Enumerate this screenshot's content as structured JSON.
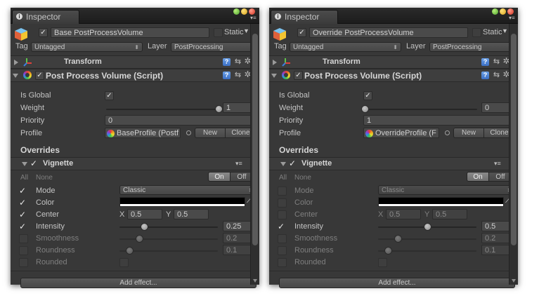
{
  "panels": [
    {
      "tab_title": "Inspector",
      "gameobject": {
        "name": "Base PostProcessVolume",
        "active": true,
        "static_label": "Static",
        "static_checked": false
      },
      "tag_label": "Tag",
      "tag_value": "Untagged",
      "layer_label": "Layer",
      "layer_value": "PostProcessing",
      "transform_title": "Transform",
      "script_title": "Post Process Volume (Script)",
      "is_global_label": "Is Global",
      "is_global": true,
      "weight_label": "Weight",
      "weight_value": "1",
      "weight_fraction": 1.0,
      "priority_label": "Priority",
      "priority_value": "0",
      "profile_label": "Profile",
      "profile_value": "BaseProfile (Postf",
      "new_label": "New",
      "clone_label": "Clone",
      "overrides_label": "Overrides",
      "effect_title": "Vignette",
      "all_label": "All",
      "none_label": "None",
      "on_label": "On",
      "off_label": "Off",
      "mode_label": "Mode",
      "mode_value": "Classic",
      "mode_enabled": true,
      "color_label": "Color",
      "color_enabled": true,
      "center_label": "Center",
      "center_x_label": "X",
      "center_x": "0.5",
      "center_y_label": "Y",
      "center_y": "0.5",
      "center_enabled": true,
      "intensity_label": "Intensity",
      "intensity_value": "0.25",
      "intensity_fraction": 0.25,
      "intensity_enabled": true,
      "smoothness_label": "Smoothness",
      "smoothness_value": "0.2",
      "smoothness_fraction": 0.2,
      "roundness_label": "Roundness",
      "roundness_value": "0.1",
      "roundness_fraction": 0.1,
      "rounded_label": "Rounded",
      "add_effect_label": "Add effect..."
    },
    {
      "tab_title": "Inspector",
      "gameobject": {
        "name": "Override PostProcessVolume",
        "active": true,
        "static_label": "Static",
        "static_checked": false
      },
      "tag_label": "Tag",
      "tag_value": "Untagged",
      "layer_label": "Layer",
      "layer_value": "PostProcessing",
      "transform_title": "Transform",
      "script_title": "Post Process Volume (Script)",
      "is_global_label": "Is Global",
      "is_global": true,
      "weight_label": "Weight",
      "weight_value": "0",
      "weight_fraction": 0.0,
      "priority_label": "Priority",
      "priority_value": "1",
      "profile_label": "Profile",
      "profile_value": "OverrideProfile (F",
      "new_label": "New",
      "clone_label": "Clone",
      "overrides_label": "Overrides",
      "effect_title": "Vignette",
      "all_label": "All",
      "none_label": "None",
      "on_label": "On",
      "off_label": "Off",
      "mode_label": "Mode",
      "mode_value": "Classic",
      "mode_enabled": false,
      "color_label": "Color",
      "color_enabled": false,
      "center_label": "Center",
      "center_x_label": "X",
      "center_x": "0.5",
      "center_y_label": "Y",
      "center_y": "0.5",
      "center_enabled": false,
      "intensity_label": "Intensity",
      "intensity_value": "0.5",
      "intensity_fraction": 0.5,
      "intensity_enabled": true,
      "smoothness_label": "Smoothness",
      "smoothness_value": "0.2",
      "smoothness_fraction": 0.2,
      "roundness_label": "Roundness",
      "roundness_value": "0.1",
      "roundness_fraction": 0.1,
      "rounded_label": "Rounded",
      "add_effect_label": "Add effect..."
    }
  ],
  "colors": {
    "panel_bg": "#383838",
    "help_blue": "#3b6fc4",
    "vignette_color": "#000000"
  },
  "icons": [
    "info-icon",
    "gameobject-cube-icon",
    "transform-axis-icon",
    "help-icon",
    "presets-icon",
    "gear-icon",
    "profile-icon",
    "object-picker-icon",
    "eyedropper-icon",
    "menu-icon"
  ]
}
